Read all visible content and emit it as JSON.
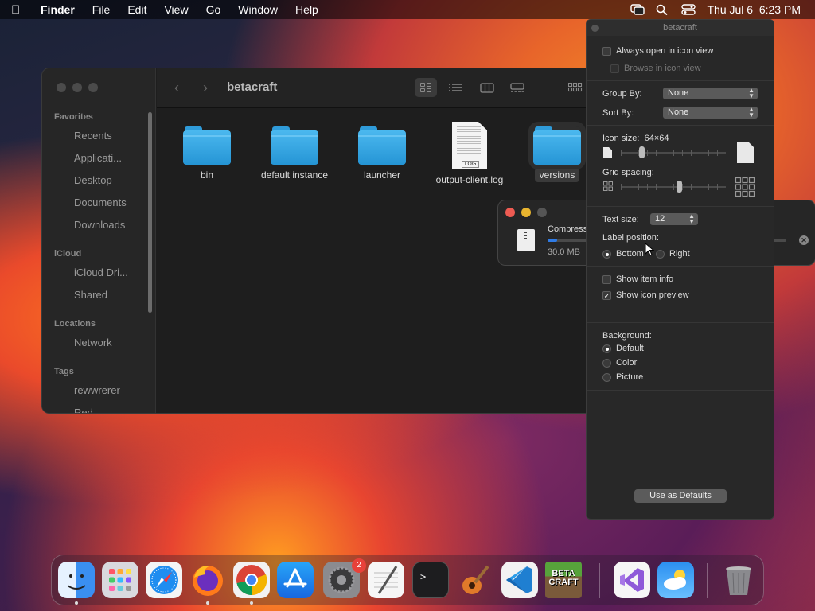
{
  "menubar": {
    "app": "Finder",
    "items": [
      "File",
      "Edit",
      "View",
      "Go",
      "Window",
      "Help"
    ],
    "datetime": "Thu Jul 6  6:23 PM"
  },
  "finder": {
    "title": "betacraft",
    "sidebar": {
      "favorites_header": "Favorites",
      "favorites": [
        "Recents",
        "Applicati...",
        "Desktop",
        "Documents",
        "Downloads"
      ],
      "icloud_header": "iCloud",
      "icloud": [
        "iCloud Dri...",
        "Shared"
      ],
      "locations_header": "Locations",
      "locations": [
        "Network"
      ],
      "tags_header": "Tags",
      "tags": [
        "rewwrerer",
        "Red"
      ]
    },
    "files": [
      {
        "name": "bin",
        "kind": "folder"
      },
      {
        "name": "default instance",
        "kind": "folder"
      },
      {
        "name": "launcher",
        "kind": "folder"
      },
      {
        "name": "output-client.log",
        "kind": "log",
        "badge": "LOG"
      },
      {
        "name": "versions",
        "kind": "folder"
      }
    ]
  },
  "progress": {
    "title": "Compress",
    "size": "30.0 MB",
    "fraction": 0.04
  },
  "inspector": {
    "title": "betacraft",
    "always_open": "Always open in icon view",
    "browse": "Browse in icon view",
    "group_by_label": "Group By:",
    "group_by": "None",
    "sort_by_label": "Sort By:",
    "sort_by": "None",
    "icon_size_label": "Icon size:",
    "icon_size": "64×64",
    "grid_spacing_label": "Grid spacing:",
    "text_size_label": "Text size:",
    "text_size": "12",
    "label_position_label": "Label position:",
    "label_bottom": "Bottom",
    "label_right": "Right",
    "show_item_info": "Show item info",
    "show_icon_preview": "Show icon preview",
    "background_label": "Background:",
    "bg_default": "Default",
    "bg_color": "Color",
    "bg_picture": "Picture",
    "use_defaults": "Use as Defaults",
    "icon_size_value": 0.2,
    "grid_spacing_value": 0.55
  },
  "dock": {
    "badge_count": "2",
    "minecraft_label": "BETA CRAFT"
  }
}
